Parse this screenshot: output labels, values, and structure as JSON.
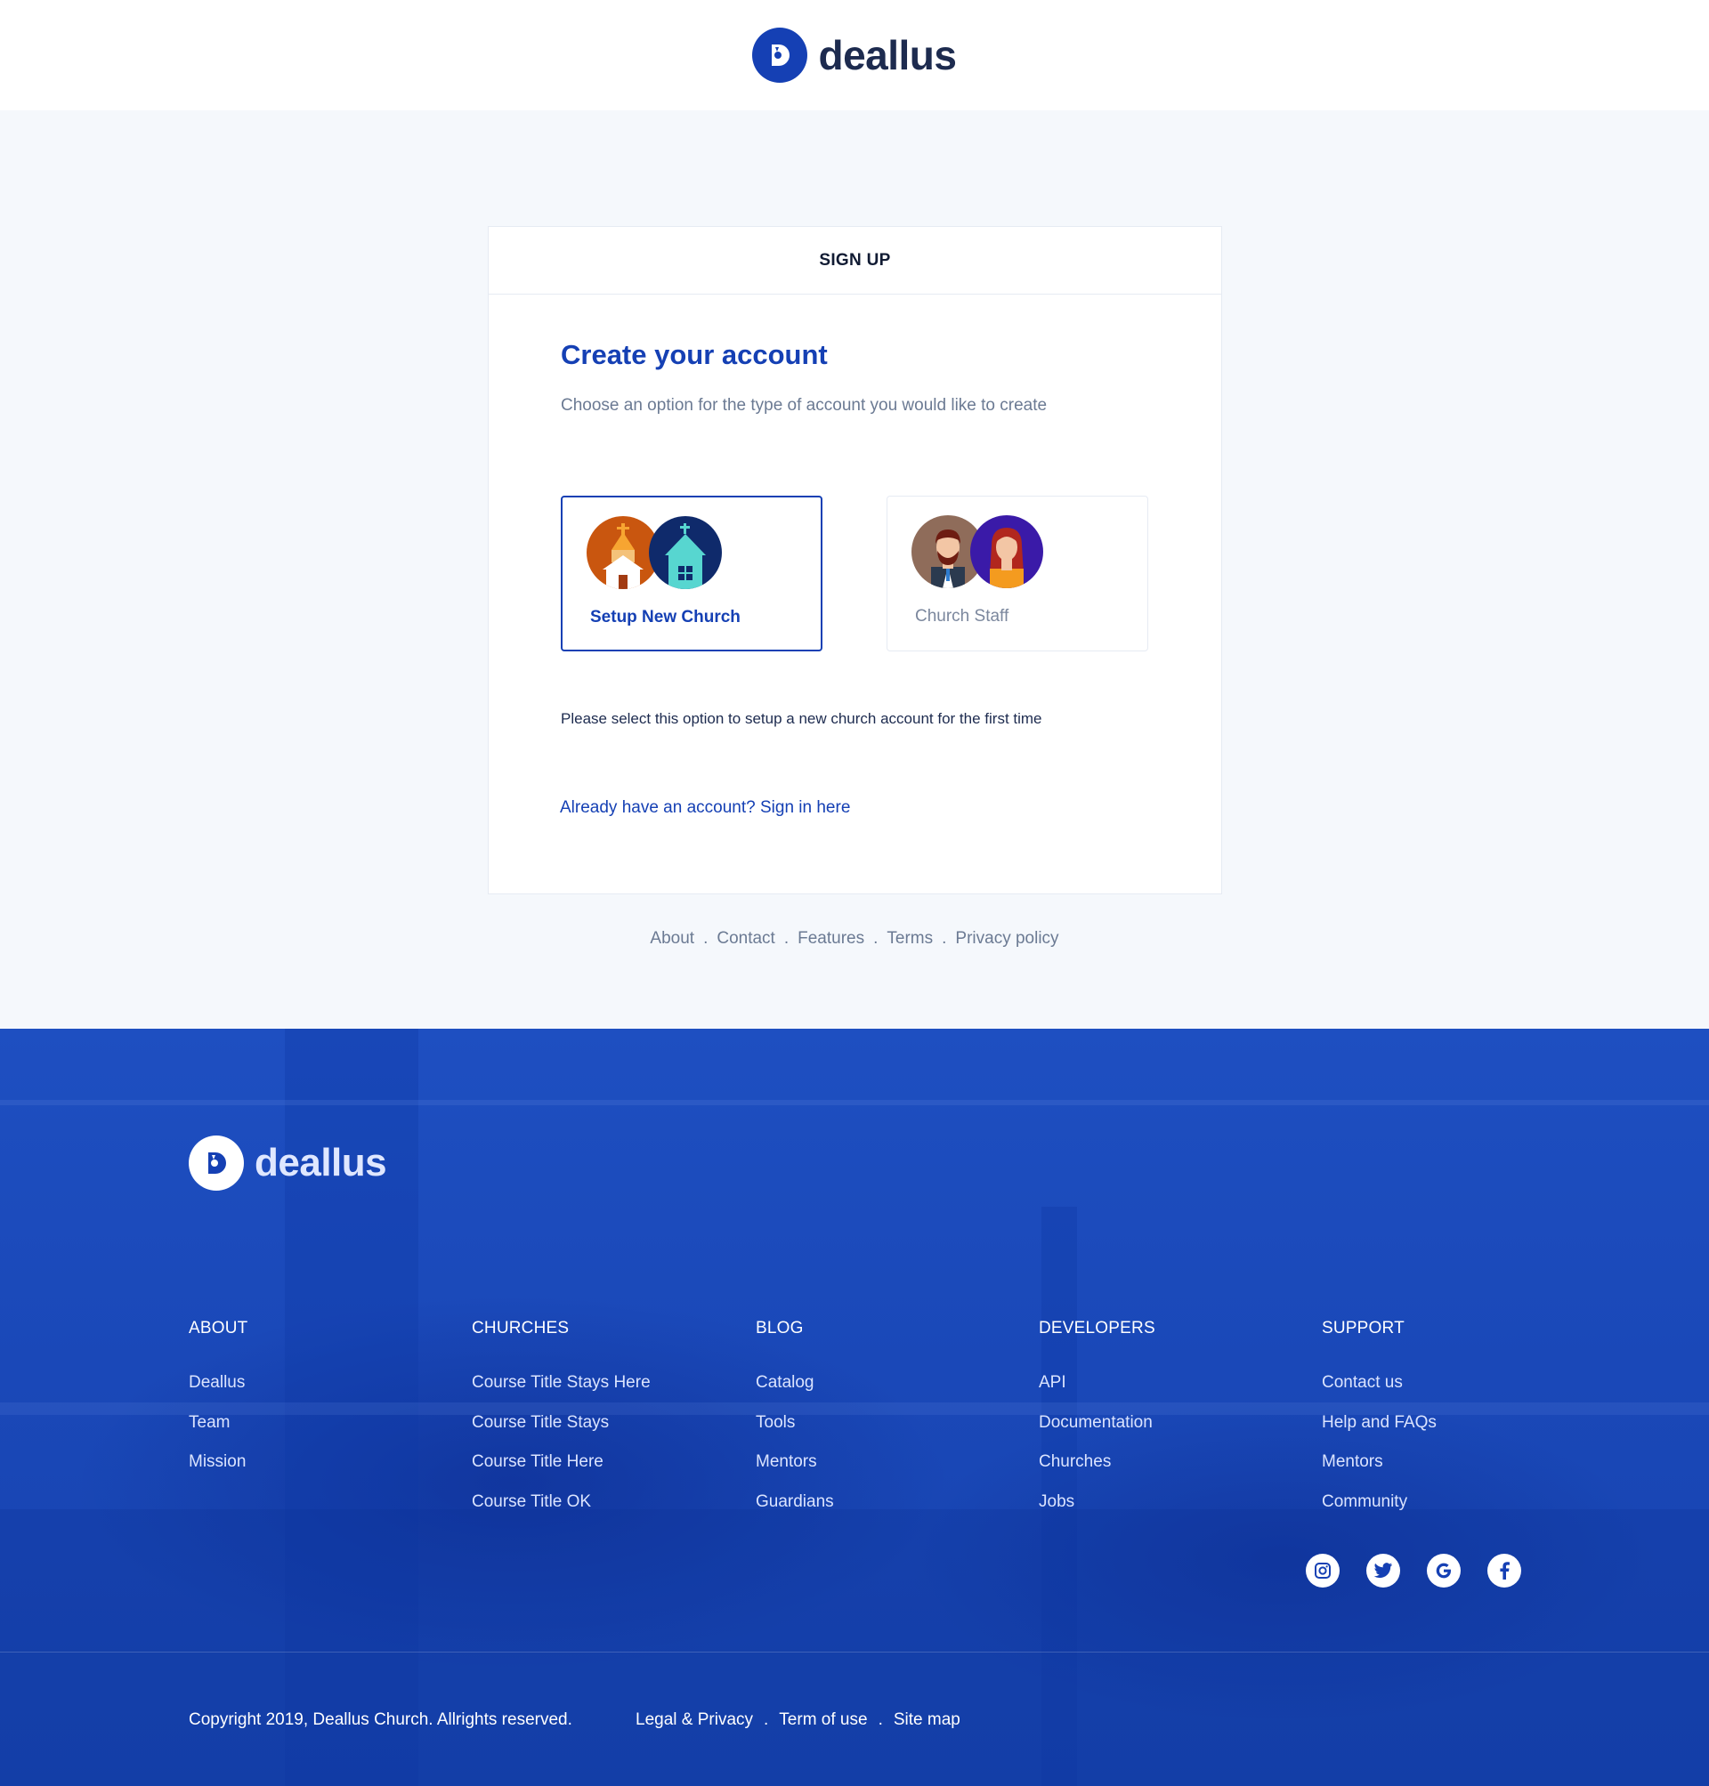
{
  "brand": {
    "name": "deallus"
  },
  "card": {
    "header": "SIGN UP",
    "title": "Create your account",
    "subtitle": "Choose an option for the type of account you would like to create",
    "options": [
      {
        "label": "Setup New Church",
        "selected": true
      },
      {
        "label": "Church Staff",
        "selected": false
      }
    ],
    "note": "Please select this option to setup a new church account for the first time",
    "signin_link": "Already have an account? Sign in here"
  },
  "below_links": [
    "About",
    "Contact",
    "Features",
    "Terms",
    "Privacy policy"
  ],
  "footer": {
    "columns": [
      {
        "title": "ABOUT",
        "links": [
          "Deallus",
          "Team",
          "Mission"
        ]
      },
      {
        "title": "CHURCHES",
        "links": [
          "Course Title Stays Here",
          "Course Title Stays",
          "Course Title Here",
          "Course Title OK"
        ]
      },
      {
        "title": "BLOG",
        "links": [
          "Catalog",
          "Tools",
          "Mentors",
          "Guardians"
        ]
      },
      {
        "title": "DEVELOPERS",
        "links": [
          "API",
          "Documentation",
          "Churches",
          "Jobs"
        ]
      },
      {
        "title": "SUPPORT",
        "links": [
          "Contact us",
          "Help and FAQs",
          "Mentors",
          "Community"
        ]
      }
    ],
    "copyright": "Copyright 2019, Deallus Church. Allrights reserved.",
    "legal_links": [
      "Legal & Privacy",
      "Term of use",
      "Site map"
    ],
    "socials": [
      "instagram-icon",
      "twitter-icon",
      "google-icon",
      "facebook-icon"
    ]
  },
  "colors": {
    "primary": "#1540b4",
    "footer_bg": "#1a48b8",
    "page_bg": "#f5f8fc"
  }
}
